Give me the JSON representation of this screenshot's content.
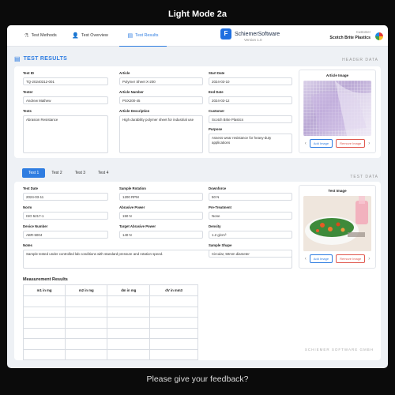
{
  "page_title": "Light Mode 2a",
  "feedback": "Please give your feedback?",
  "nav": {
    "tabs": [
      {
        "label": "Test Methods",
        "icon": "flask-icon"
      },
      {
        "label": "Test Overview",
        "icon": "user-icon"
      },
      {
        "label": "Test Results",
        "icon": "document-icon",
        "active": true
      }
    ],
    "brand": {
      "name": "SchiemerSoftware",
      "version": "Version 1.0"
    },
    "customer": {
      "label": "Customer",
      "name": "Scotch Brite Plastics"
    }
  },
  "results": {
    "heading": "TEST RESULTS",
    "side_tag": "HEADER DATA",
    "fields": {
      "test_id": {
        "label": "Test ID",
        "value": "TQ-20240312-001"
      },
      "tester": {
        "label": "Tester",
        "value": "Andrew Mathew"
      },
      "tests": {
        "label": "Tests",
        "value": "Abrasion Resistance"
      },
      "article": {
        "label": "Article",
        "value": "Polymer Sheet X-200"
      },
      "article_number": {
        "label": "Article Number",
        "value": "PSX200-45"
      },
      "article_description": {
        "label": "Article Description",
        "value": "High durability polymer sheet for industrial use"
      },
      "start_date": {
        "label": "Start Date",
        "value": "2024-03-10"
      },
      "end_date": {
        "label": "End Date",
        "value": "2024-03-12"
      },
      "customer": {
        "label": "Customer",
        "value": "Scotch Brite Plastics"
      },
      "purpose": {
        "label": "Purpose",
        "value": "Assess wear resistance for heavy-duty applications"
      }
    },
    "image": {
      "title": "Article Image",
      "add": "Add Image",
      "remove": "Remove Image"
    }
  },
  "test_tabs": [
    "Test 1",
    "Test 2",
    "Test 3",
    "Test 4"
  ],
  "test_data": {
    "side_tag": "TEST DATA",
    "fields": {
      "test_date": {
        "label": "Test Date",
        "value": "2024-03-11"
      },
      "norm": {
        "label": "Norm",
        "value": "ISO 5217-1"
      },
      "device_number": {
        "label": "Device Number",
        "value": "ABR-5004"
      },
      "notes": {
        "label": "Notes",
        "value": "Sample tested under controlled lab conditions with standard pressure and rotation speed."
      },
      "sample_rotation": {
        "label": "Sample Rotation",
        "value": "1200 RPM"
      },
      "abrasive_power": {
        "label": "Abrasive Power",
        "value": "150 N"
      },
      "target_abrasive_power": {
        "label": "Target Abrasive Power",
        "value": "140 N"
      },
      "downforce": {
        "label": "Downforce",
        "value": "50 N"
      },
      "pre_treatment": {
        "label": "Pre-Treatment",
        "value": "None"
      },
      "density": {
        "label": "Density",
        "value": "1.2 g/cm³"
      },
      "sample_shape": {
        "label": "Sample Shape",
        "value": "Circular, 50mm diameter"
      }
    },
    "image": {
      "title": "Test Image",
      "add": "Add Image",
      "remove": "Remove Image"
    },
    "measurement": {
      "title": "Measurement Results",
      "columns": [
        "m1 in mg",
        "m2 in mg",
        "dm in mg",
        "dV in mm3"
      ]
    },
    "footer_brand": "SCHIEMER SOFTWARE GMBH"
  }
}
